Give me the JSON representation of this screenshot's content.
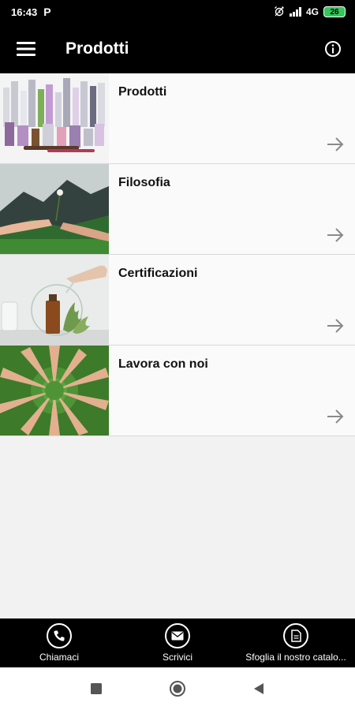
{
  "status_bar": {
    "time": "16:43",
    "app_indicator": "P",
    "network": "4G",
    "battery": "26"
  },
  "app_bar": {
    "title": "Prodotti",
    "menu_icon": "hamburger-menu-icon",
    "info_icon": "info-icon"
  },
  "list": {
    "items": [
      {
        "title": "Prodotti",
        "image": "cosmetic-products-photo"
      },
      {
        "title": "Filosofia",
        "image": "hands-holding-flower-photo"
      },
      {
        "title": "Certificazioni",
        "image": "lab-bottle-plants-photo"
      },
      {
        "title": "Lavora con noi",
        "image": "hands-circle-grass-photo"
      }
    ]
  },
  "bottom_bar": {
    "items": [
      {
        "label": "Chiamaci",
        "icon": "phone-icon"
      },
      {
        "label": "Scrivici",
        "icon": "mail-icon"
      },
      {
        "label": "Sfoglia il nostro catalo...",
        "icon": "document-icon"
      }
    ]
  },
  "colors": {
    "bars": "#000000",
    "background": "#f2f2f2",
    "battery": "#34c759",
    "arrow": "#8a8a8a"
  }
}
